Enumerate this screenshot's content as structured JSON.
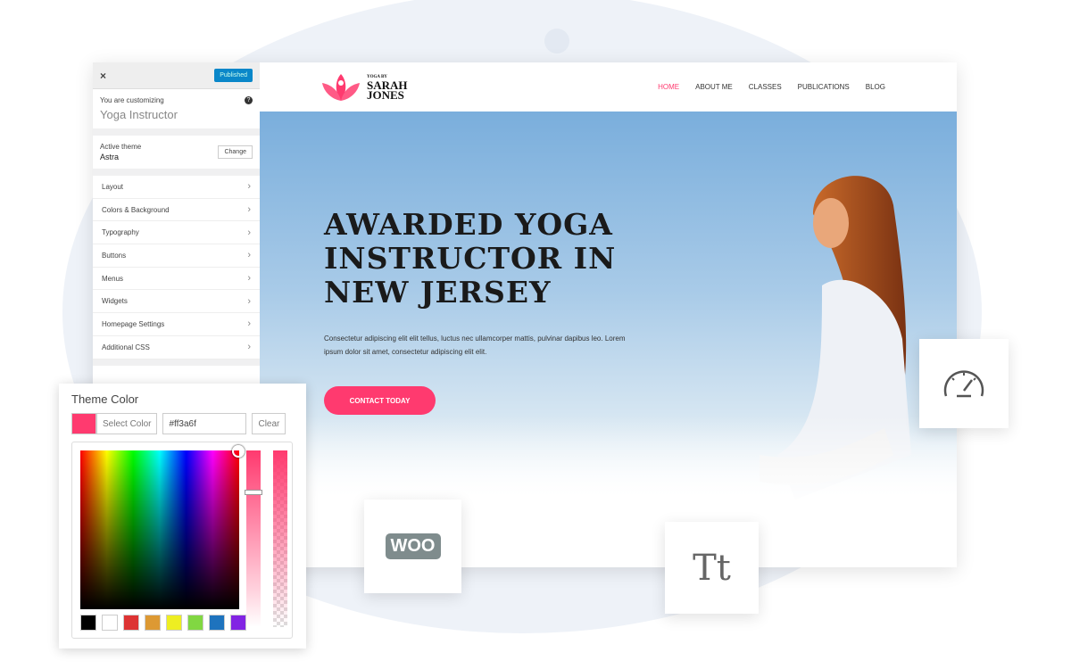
{
  "sidebar": {
    "close": "×",
    "publish": "Published",
    "customizing_label": "You are customizing",
    "site_name": "Yoga Instructor",
    "help": "?",
    "theme_label": "Active theme",
    "theme_name": "Astra",
    "change": "Change",
    "items": [
      {
        "label": "Layout"
      },
      {
        "label": "Colors & Background"
      },
      {
        "label": "Typography"
      },
      {
        "label": "Buttons"
      },
      {
        "label": "Menus"
      },
      {
        "label": "Widgets"
      },
      {
        "label": "Homepage Settings"
      },
      {
        "label": "Additional CSS"
      }
    ]
  },
  "site": {
    "logo": {
      "small": "YOGA BY",
      "line1": "SARAH",
      "line2": "JONES"
    },
    "nav": [
      {
        "label": "HOME"
      },
      {
        "label": "ABOUT ME"
      },
      {
        "label": "CLASSES"
      },
      {
        "label": "PUBLICATIONS"
      },
      {
        "label": "BLOG"
      }
    ],
    "hero_title": "AWARDED YOGA INSTRUCTOR IN NEW JERSEY",
    "hero_text": "Consectetur adipiscing elit elit tellus, luctus nec ullamcorper mattis, pulvinar dapibus leo. Lorem ipsum dolor sit amet, consectetur adipiscing elit elit.",
    "cta": "CONTACT TODAY"
  },
  "picker": {
    "title": "Theme Color",
    "select": "Select Color",
    "value": "#ff3a6f",
    "clear": "Clear",
    "accent": "#ff3a6f",
    "palette": [
      "#000000",
      "#ffffff",
      "#dd3333",
      "#dd9933",
      "#eeee22",
      "#81d742",
      "#1e73be",
      "#8224e3"
    ]
  },
  "cards": {
    "woo": "WOO",
    "typography": "Tt"
  }
}
